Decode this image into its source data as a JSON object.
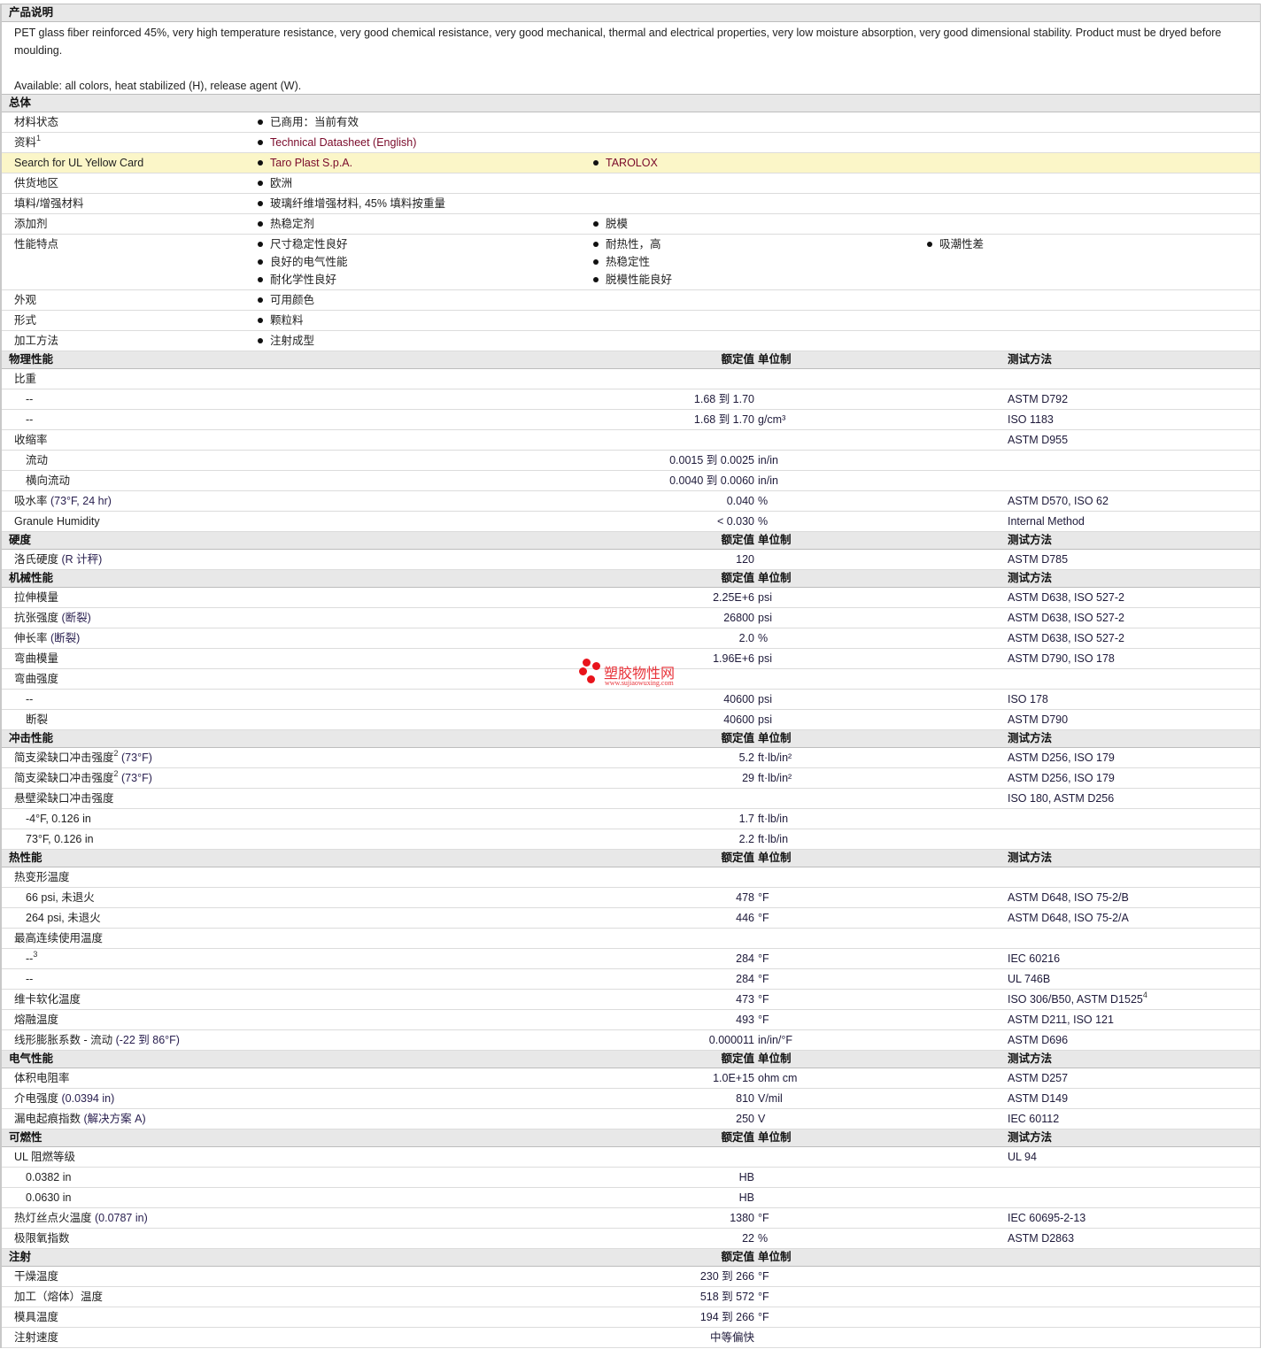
{
  "description": {
    "title": "产品说明",
    "text": "PET glass fiber reinforced 45%, very high temperature resistance, very good chemical resistance, very good mechanical, thermal and electrical properties, very low moisture absorption, very good dimensional stability. Product must be dryed before moulding.",
    "available": "Available: all colors, heat stabilized (H), release agent (W)."
  },
  "general": {
    "title": "总体",
    "rows": [
      {
        "label": "材料状态",
        "cols": [
          [
            "已商用：当前有效"
          ]
        ]
      },
      {
        "label": "资料",
        "sup": "1",
        "link": true,
        "cols": [
          [
            "Technical Datasheet (English)"
          ]
        ]
      },
      {
        "label": "Search for UL Yellow Card",
        "link": true,
        "highlight": true,
        "cols": [
          [
            "Taro Plast S.p.A."
          ],
          [
            "TAROLOX"
          ]
        ]
      },
      {
        "label": "供货地区",
        "cols": [
          [
            "欧洲"
          ]
        ]
      },
      {
        "label": "填料/增强材料",
        "cols": [
          [
            "玻璃纤维增强材料, 45% 填料按重量"
          ]
        ]
      },
      {
        "label": "添加剂",
        "cols": [
          [
            "热稳定剂"
          ],
          [
            "脱模"
          ]
        ]
      },
      {
        "label": "性能特点",
        "cols": [
          [
            "尺寸稳定性良好",
            "良好的电气性能",
            "耐化学性良好"
          ],
          [
            "耐热性，高",
            "热稳定性",
            "脱模性能良好"
          ],
          [
            "吸潮性差"
          ]
        ]
      },
      {
        "label": "外观",
        "cols": [
          [
            "可用颜色"
          ]
        ]
      },
      {
        "label": "形式",
        "cols": [
          [
            "颗粒料"
          ]
        ]
      },
      {
        "label": "加工方法",
        "cols": [
          [
            "注射成型"
          ]
        ]
      }
    ]
  },
  "sections": [
    {
      "title": "物理性能",
      "col_value": "额定值",
      "col_unit": "单位制",
      "col_method": "测试方法",
      "rows": [
        {
          "label": "比重"
        },
        {
          "label": "--",
          "indent": true,
          "value": "1.68 到  1.70",
          "unit": "",
          "method": "ASTM D792"
        },
        {
          "label": "--",
          "indent": true,
          "value": "1.68 到  1.70",
          "unit": "g/cm³",
          "method": "ISO 1183"
        },
        {
          "label": "收缩率",
          "method": "ASTM D955"
        },
        {
          "label": "流动",
          "indent": true,
          "value": "0.0015 到  0.0025",
          "unit": "in/in"
        },
        {
          "label": "横向流动",
          "indent": true,
          "value": "0.0040 到  0.0060",
          "unit": "in/in"
        },
        {
          "label": "吸水率",
          "note": " (73°F, 24 hr)",
          "value": "0.040",
          "unit": "%",
          "method": "ASTM D570, ISO 62"
        },
        {
          "label": "Granule Humidity",
          "value": "< 0.030",
          "unit": "%",
          "method": "Internal Method"
        }
      ]
    },
    {
      "title": "硬度",
      "col_value": "额定值",
      "col_unit": "单位制",
      "col_method": "测试方法",
      "rows": [
        {
          "label": "洛氏硬度",
          "note": " (R 计秤)",
          "value": "120",
          "unit": "",
          "method": "ASTM D785"
        }
      ]
    },
    {
      "title": "机械性能",
      "col_value": "额定值",
      "col_unit": "单位制",
      "col_method": "测试方法",
      "rows": [
        {
          "label": "拉伸模量",
          "value": "2.25E+6",
          "unit": "psi",
          "method": "ASTM D638, ISO 527-2"
        },
        {
          "label": "抗张强度",
          "note": " (断裂)",
          "value": "26800",
          "unit": "psi",
          "method": "ASTM D638, ISO 527-2"
        },
        {
          "label": "伸长率",
          "note": " (断裂)",
          "value": "2.0",
          "unit": "%",
          "method": "ASTM D638, ISO 527-2"
        },
        {
          "label": "弯曲模量",
          "value": "1.96E+6",
          "unit": "psi",
          "method": "ASTM D790, ISO 178"
        },
        {
          "label": "弯曲强度"
        },
        {
          "label": "--",
          "indent": true,
          "value": "40600",
          "unit": "psi",
          "method": "ISO 178"
        },
        {
          "label": "断裂",
          "indent": true,
          "value": "40600",
          "unit": "psi",
          "method": "ASTM D790"
        }
      ]
    },
    {
      "title": "冲击性能",
      "col_value": "额定值",
      "col_unit": "单位制",
      "col_method": "测试方法",
      "rows": [
        {
          "label": "简支梁缺口冲击强度",
          "sup": "2",
          "note": " (73°F)",
          "value": "5.2",
          "unit": "ft·lb/in²",
          "method": "ASTM D256, ISO 179"
        },
        {
          "label": "简支梁缺口冲击强度",
          "sup": "2",
          "note": " (73°F)",
          "value": "29",
          "unit": "ft·lb/in²",
          "method": "ASTM D256, ISO 179"
        },
        {
          "label": "悬壁梁缺口冲击强度",
          "method": "ISO 180, ASTM D256"
        },
        {
          "label": "-4°F, 0.126 in",
          "indent": true,
          "value": "1.7",
          "unit": "ft·lb/in"
        },
        {
          "label": "73°F, 0.126 in",
          "indent": true,
          "value": "2.2",
          "unit": "ft·lb/in"
        }
      ]
    },
    {
      "title": "热性能",
      "col_value": "额定值",
      "col_unit": "单位制",
      "col_method": "测试方法",
      "rows": [
        {
          "label": "热变形温度"
        },
        {
          "label": "66 psi, 未退火",
          "indent": true,
          "value": "478",
          "unit": "°F",
          "method": "ASTM D648, ISO 75-2/B"
        },
        {
          "label": "264 psi, 未退火",
          "indent": true,
          "value": "446",
          "unit": "°F",
          "method": "ASTM D648, ISO 75-2/A"
        },
        {
          "label": "最高连续使用温度"
        },
        {
          "label": "--",
          "sup": "3",
          "indent": true,
          "value": "284",
          "unit": "°F",
          "method": "IEC 60216"
        },
        {
          "label": "--",
          "indent": true,
          "value": "284",
          "unit": "°F",
          "method": "UL 746B"
        },
        {
          "label": "维卡软化温度",
          "value": "473",
          "unit": "°F",
          "method": "ISO 306/B50, ASTM D1525",
          "method_sup": "4"
        },
        {
          "label": "熔融温度",
          "value": "493",
          "unit": "°F",
          "method": "ASTM D211, ISO 121"
        },
        {
          "label": "线形膨胀系数 - 流动",
          "note": " (-22 到  86°F)",
          "value": "0.000011",
          "unit": "in/in/°F",
          "method": "ASTM D696"
        }
      ]
    },
    {
      "title": "电气性能",
      "col_value": "额定值",
      "col_unit": "单位制",
      "col_method": "测试方法",
      "rows": [
        {
          "label": "体积电阻率",
          "value": "1.0E+15",
          "unit": "ohm cm",
          "method": "ASTM D257"
        },
        {
          "label": "介电强度",
          "note": " (0.0394 in)",
          "value": "810",
          "unit": "V/mil",
          "method": "ASTM D149"
        },
        {
          "label": "漏电起痕指数",
          "note": " (解决方案  A)",
          "value": "250",
          "unit": "V",
          "method": "IEC 60112"
        }
      ]
    },
    {
      "title": "可燃性",
      "col_value": "额定值",
      "col_unit": "单位制",
      "col_method": "测试方法",
      "rows": [
        {
          "label": "UL 阻燃等级",
          "method": "UL 94"
        },
        {
          "label": "0.0382 in",
          "indent": true,
          "value": "HB"
        },
        {
          "label": "0.0630 in",
          "indent": true,
          "value": "HB"
        },
        {
          "label": "热灯丝点火温度",
          "note": " (0.0787 in)",
          "value": "1380",
          "unit": "°F",
          "method": "IEC 60695-2-13"
        },
        {
          "label": "极限氧指数",
          "value": "22",
          "unit": "%",
          "method": "ASTM D2863"
        }
      ]
    },
    {
      "title": "注射",
      "col_value": "额定值",
      "col_unit": "单位制",
      "rows": [
        {
          "label": "干燥温度",
          "value": "230 到  266",
          "unit": "°F"
        },
        {
          "label": "加工（熔体）温度",
          "value": "518 到  572",
          "unit": "°F"
        },
        {
          "label": "模具温度",
          "value": "194 到  266",
          "unit": "°F"
        },
        {
          "label": "注射速度",
          "value": "中等偏快"
        }
      ]
    }
  ],
  "watermark": {
    "name": "塑胶物性网",
    "url": "www.sujiaowuxing.com"
  }
}
